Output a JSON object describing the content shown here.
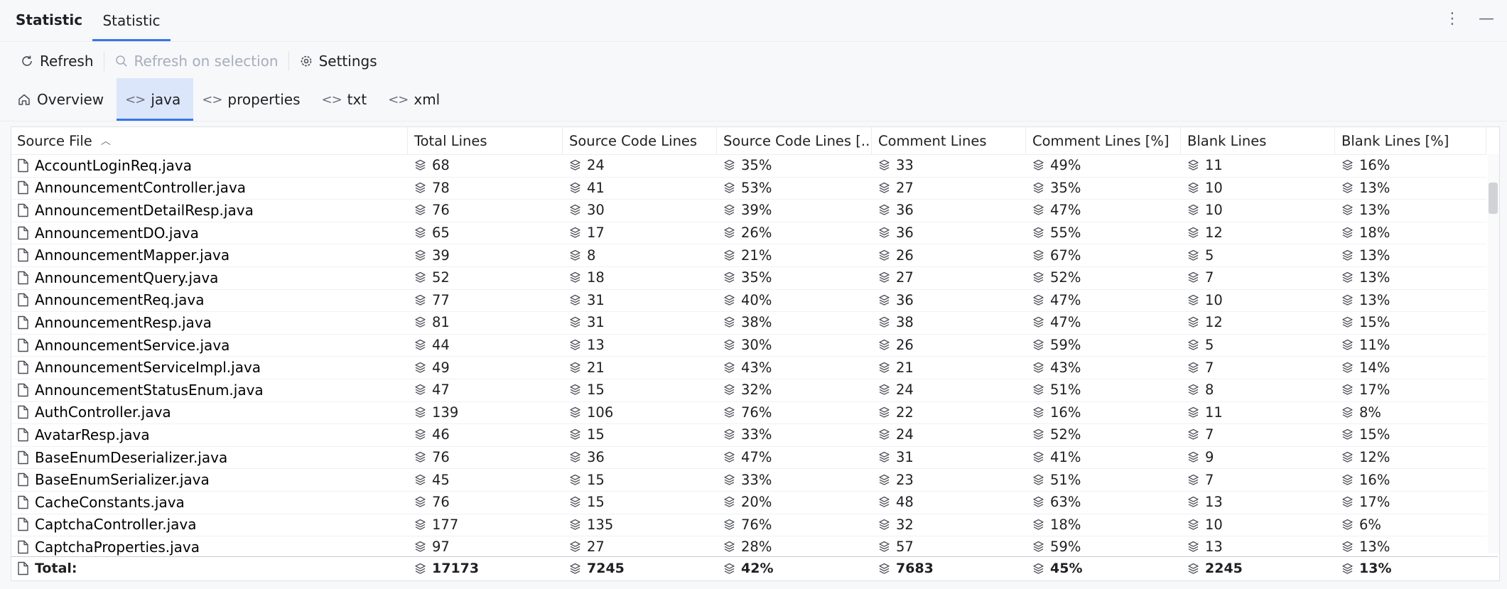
{
  "window": {
    "title": "Statistic",
    "tab": "Statistic"
  },
  "toolbar": {
    "refresh": "Refresh",
    "refresh_selection": "Refresh on selection",
    "settings": "Settings"
  },
  "file_tabs": [
    {
      "label": "Overview",
      "icon": "home-icon"
    },
    {
      "label": "java",
      "icon": "code-icon"
    },
    {
      "label": "properties",
      "icon": "code-icon"
    },
    {
      "label": "txt",
      "icon": "code-icon"
    },
    {
      "label": "xml",
      "icon": "code-icon"
    }
  ],
  "active_tab": "java",
  "table": {
    "columns": [
      "Source File",
      "Total Lines",
      "Source Code Lines",
      "Source Code Lines [...",
      "Comment Lines",
      "Comment Lines [%]",
      "Blank Lines",
      "Blank Lines [%]"
    ],
    "rows": [
      [
        "AccountLoginReq.java",
        "68",
        "24",
        "35%",
        "33",
        "49%",
        "11",
        "16%"
      ],
      [
        "AnnouncementController.java",
        "78",
        "41",
        "53%",
        "27",
        "35%",
        "10",
        "13%"
      ],
      [
        "AnnouncementDetailResp.java",
        "76",
        "30",
        "39%",
        "36",
        "47%",
        "10",
        "13%"
      ],
      [
        "AnnouncementDO.java",
        "65",
        "17",
        "26%",
        "36",
        "55%",
        "12",
        "18%"
      ],
      [
        "AnnouncementMapper.java",
        "39",
        "8",
        "21%",
        "26",
        "67%",
        "5",
        "13%"
      ],
      [
        "AnnouncementQuery.java",
        "52",
        "18",
        "35%",
        "27",
        "52%",
        "7",
        "13%"
      ],
      [
        "AnnouncementReq.java",
        "77",
        "31",
        "40%",
        "36",
        "47%",
        "10",
        "13%"
      ],
      [
        "AnnouncementResp.java",
        "81",
        "31",
        "38%",
        "38",
        "47%",
        "12",
        "15%"
      ],
      [
        "AnnouncementService.java",
        "44",
        "13",
        "30%",
        "26",
        "59%",
        "5",
        "11%"
      ],
      [
        "AnnouncementServiceImpl.java",
        "49",
        "21",
        "43%",
        "21",
        "43%",
        "7",
        "14%"
      ],
      [
        "AnnouncementStatusEnum.java",
        "47",
        "15",
        "32%",
        "24",
        "51%",
        "8",
        "17%"
      ],
      [
        "AuthController.java",
        "139",
        "106",
        "76%",
        "22",
        "16%",
        "11",
        "8%"
      ],
      [
        "AvatarResp.java",
        "46",
        "15",
        "33%",
        "24",
        "52%",
        "7",
        "15%"
      ],
      [
        "BaseEnumDeserializer.java",
        "76",
        "36",
        "47%",
        "31",
        "41%",
        "9",
        "12%"
      ],
      [
        "BaseEnumSerializer.java",
        "45",
        "15",
        "33%",
        "23",
        "51%",
        "7",
        "16%"
      ],
      [
        "CacheConstants.java",
        "76",
        "15",
        "20%",
        "48",
        "63%",
        "13",
        "17%"
      ],
      [
        "CaptchaController.java",
        "177",
        "135",
        "76%",
        "32",
        "18%",
        "10",
        "6%"
      ],
      [
        "CaptchaProperties.java",
        "97",
        "27",
        "28%",
        "57",
        "59%",
        "13",
        "13%"
      ]
    ],
    "total": [
      "Total:",
      "17173",
      "7245",
      "42%",
      "7683",
      "45%",
      "2245",
      "13%"
    ]
  }
}
